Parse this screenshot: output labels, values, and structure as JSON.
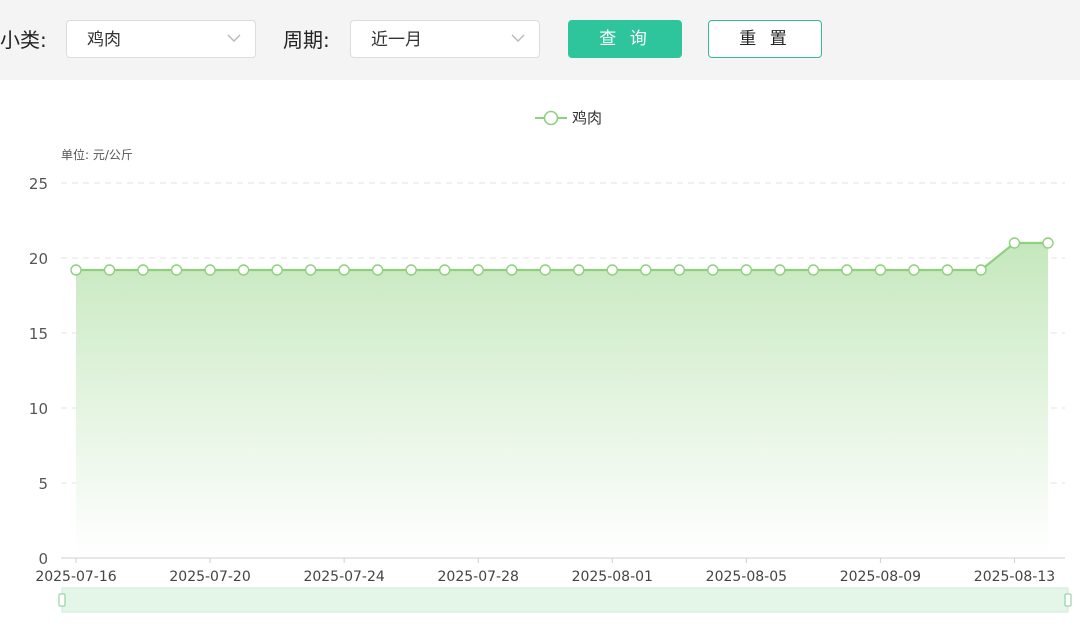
{
  "filters": {
    "category_label": "小类:",
    "category_value": "鸡肉",
    "period_label": "周期:",
    "period_value": "近一月",
    "query_button": "查 询",
    "reset_button": "重 置"
  },
  "colors": {
    "accent": "#2fc59c",
    "series_line": "#8fd07f"
  },
  "chart_data": {
    "type": "line",
    "area_fill": true,
    "unit_label": "单位: 元/公斤",
    "legend": [
      "鸡肉"
    ],
    "legend_position": "top-center",
    "ylim": [
      0,
      25
    ],
    "y_ticks": [
      0,
      5,
      10,
      15,
      20,
      25
    ],
    "x_tick_labels": [
      "2025-07-16",
      "2025-07-20",
      "2025-07-24",
      "2025-07-28",
      "2025-08-01",
      "2025-08-05",
      "2025-08-09",
      "2025-08-13"
    ],
    "grid": "horizontal dashed",
    "x": [
      "2025-07-16",
      "2025-07-17",
      "2025-07-18",
      "2025-07-19",
      "2025-07-20",
      "2025-07-21",
      "2025-07-22",
      "2025-07-23",
      "2025-07-24",
      "2025-07-25",
      "2025-07-26",
      "2025-07-27",
      "2025-07-28",
      "2025-07-29",
      "2025-07-30",
      "2025-07-31",
      "2025-08-01",
      "2025-08-02",
      "2025-08-03",
      "2025-08-04",
      "2025-08-05",
      "2025-08-06",
      "2025-08-07",
      "2025-08-08",
      "2025-08-09",
      "2025-08-10",
      "2025-08-11",
      "2025-08-12",
      "2025-08-13",
      "2025-08-14"
    ],
    "series": [
      {
        "name": "鸡肉",
        "values": [
          19.2,
          19.2,
          19.2,
          19.2,
          19.2,
          19.2,
          19.2,
          19.2,
          19.2,
          19.2,
          19.2,
          19.2,
          19.2,
          19.2,
          19.2,
          19.2,
          19.2,
          19.2,
          19.2,
          19.2,
          19.2,
          19.2,
          19.2,
          19.2,
          19.2,
          19.2,
          19.2,
          19.2,
          21.0,
          21.0
        ]
      }
    ],
    "data_zoom_slider": true
  }
}
